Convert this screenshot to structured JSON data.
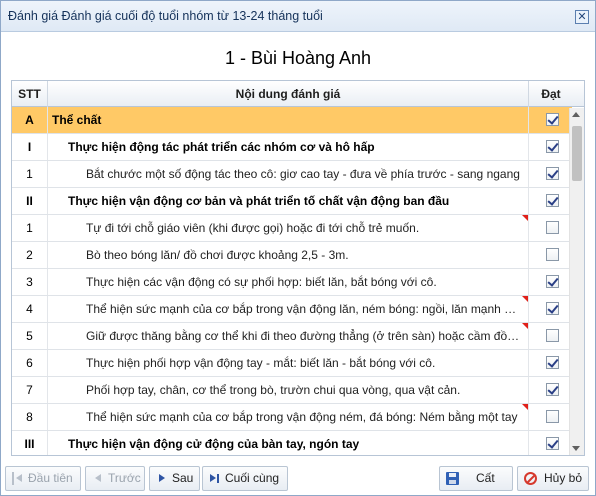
{
  "window": {
    "title": "Đánh giá Đánh giá cuối độ tuổi nhóm từ 13-24 tháng tuổi",
    "close_label": "✕"
  },
  "student": {
    "name": "1 - Bùi Hoàng Anh"
  },
  "grid": {
    "headers": {
      "stt": "STT",
      "content": "Nội dung đánh giá",
      "dat": "Đạt"
    },
    "rows": [
      {
        "stt": "A",
        "content": "Thể chất",
        "level": "a",
        "checked": true,
        "flag": false
      },
      {
        "stt": "I",
        "content": "Thực hiện động tác phát triển các nhóm cơ và hô hấp",
        "level": "1",
        "checked": true,
        "flag": false
      },
      {
        "stt": "1",
        "content": "Bắt chước một số động tác theo cô: giơ cao tay - đưa về phía trước - sang ngang",
        "level": "2",
        "checked": true,
        "flag": false
      },
      {
        "stt": "II",
        "content": "Thực hiện vận động cơ bản và phát triển tố chất vận động ban đầu",
        "level": "1",
        "checked": true,
        "flag": false
      },
      {
        "stt": "1",
        "content": "Tự đi tới chỗ giáo viên (khi được gọi) hoặc đi tới chỗ trẻ muốn.",
        "level": "2",
        "checked": false,
        "flag": true
      },
      {
        "stt": "2",
        "content": "Bò theo bóng lăn/ đồ chơi được khoảng 2,5 - 3m.",
        "level": "2",
        "checked": false,
        "flag": false
      },
      {
        "stt": "3",
        "content": "Thực hiện các vận động có sự phối hợp: biết lăn, bắt bóng với cô.",
        "level": "2",
        "checked": true,
        "flag": false
      },
      {
        "stt": "4",
        "content": "Thể hiện sức mạnh của cơ bắp trong vận động lăn, ném bóng: ngồi, lăn mạnh bóng",
        "level": "2",
        "checked": true,
        "flag": true
      },
      {
        "stt": "5",
        "content": "Giữ được thăng bằng cơ thể khi đi theo đường thẳng (ở trên sàn) hoặc cầm đồ vật",
        "level": "2",
        "checked": false,
        "flag": true
      },
      {
        "stt": "6",
        "content": "Thực hiện phối hợp vận động tay - mắt: biết lăn - bắt bóng với cô.",
        "level": "2",
        "checked": true,
        "flag": false
      },
      {
        "stt": "7",
        "content": "Phối hợp tay, chân, cơ thể trong bò, trườn chui qua vòng, qua vật cản.",
        "level": "2",
        "checked": true,
        "flag": false
      },
      {
        "stt": "8",
        "content": "Thể hiện sức mạnh của cơ bắp trong vận động ném, đá bóng: Ném bằng một tay",
        "level": "2",
        "checked": false,
        "flag": true
      },
      {
        "stt": "III",
        "content": "Thực hiện vận động cử động của bàn tay, ngón tay",
        "level": "1",
        "checked": true,
        "flag": false
      }
    ]
  },
  "footer": {
    "first_label": "Đầu tiên",
    "prev_label": "Trước",
    "next_label": "Sau",
    "last_label": "Cuối cùng",
    "save_label": "Cất",
    "cancel_label": "Hủy bỏ"
  },
  "colors": {
    "category_row": "#ffc966",
    "flag": "#e0211a",
    "accent": "#2f55a4"
  }
}
